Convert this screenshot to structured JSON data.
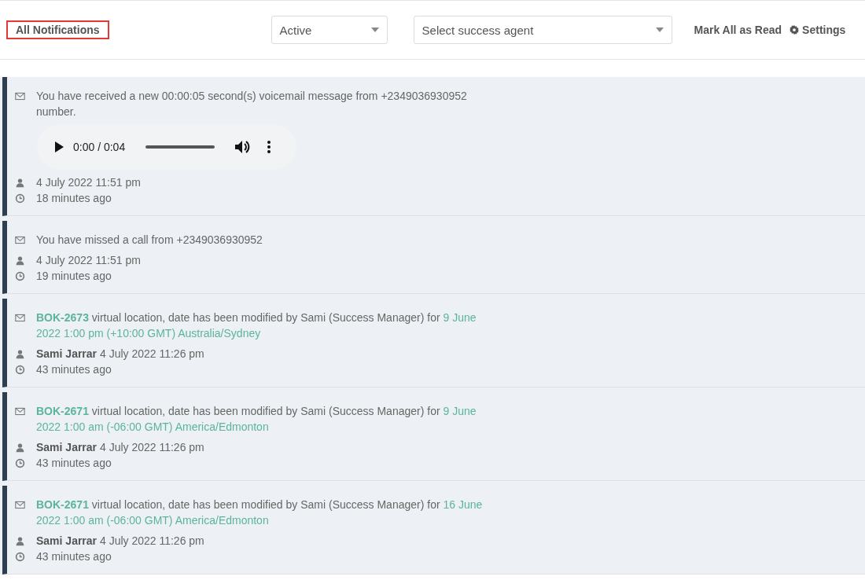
{
  "header": {
    "title": "All Notifications",
    "status_select": {
      "value": "Active"
    },
    "agent_select": {
      "placeholder": "Select success agent"
    },
    "mark_all_read": "Mark All as Read",
    "settings": "Settings"
  },
  "notifications": [
    {
      "kind": "voicemail",
      "message": "You have received a new 00:00:05 second(s) voicemail message from +2349036930952 number.",
      "player": {
        "time": "0:00 / 0:04"
      },
      "meta": "4 July 2022 11:51 pm",
      "ago": "18 minutes ago"
    },
    {
      "kind": "call",
      "message": "You have missed a call from +2349036930952",
      "meta": "4 July 2022 11:51 pm",
      "ago": "19 minutes ago"
    },
    {
      "kind": "booking",
      "ref": "BOK-2673",
      "message": "virtual location, date has been modified by Sami (Success Manager) for",
      "when": "9 June 2022 1:00 pm (+10:00 GMT) Australia/Sydney",
      "meta": "**Sami Jarrar** 4 July 2022 11:26 pm",
      "ago": "43 minutes ago"
    },
    {
      "kind": "booking",
      "ref": "BOK-2671",
      "message": "virtual location, date has been modified by Sami (Success Manager) for",
      "when": "9 June 2022 1:00 am (-06:00 GMT) America/Edmonton",
      "meta": "**Sami Jarrar** 4 July 2022 11:26 pm",
      "ago": "43 minutes ago"
    },
    {
      "kind": "booking",
      "ref": "BOK-2671",
      "message": "virtual location, date has been modified by Sami (Success Manager) for",
      "when": "16 June 2022 1:00 am (-06:00 GMT) America/Edmonton",
      "meta": "**Sami Jarrar** 4 July 2022 11:26 pm",
      "ago": "43 minutes ago"
    }
  ]
}
